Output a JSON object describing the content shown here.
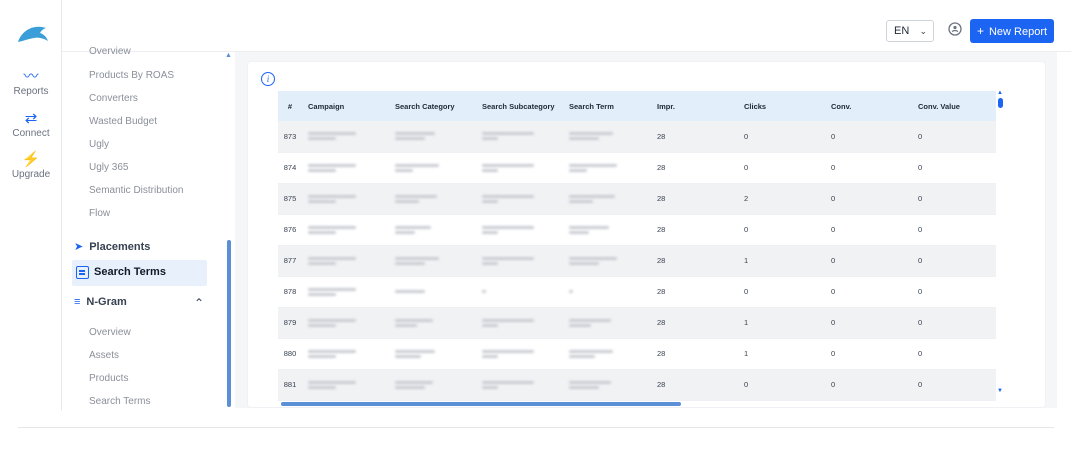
{
  "rail": {
    "items": [
      {
        "label": "Reports",
        "icon": "chart-trend-icon"
      },
      {
        "label": "Connect",
        "icon": "arrows-exchange-icon"
      },
      {
        "label": "Upgrade",
        "icon": "lightning-icon"
      }
    ]
  },
  "header": {
    "language": "EN",
    "new_report_label": "New Report"
  },
  "subnav": {
    "top_items": [
      "Overview",
      "Products By ROAS",
      "Converters",
      "Wasted Budget",
      "Ugly",
      "Ugly 365",
      "Semantic Distribution",
      "Flow"
    ],
    "placements_label": "Placements",
    "active_label": "Search Terms",
    "ngram_label": "N-Gram",
    "ngram_items": [
      "Overview",
      "Assets",
      "Products",
      "Search Terms"
    ]
  },
  "table": {
    "columns": [
      "#",
      "Campaign",
      "Search Category",
      "Search Subcategory",
      "Search Term",
      "Impr.",
      "Clicks",
      "Conv.",
      "Conv. Value"
    ],
    "rows": [
      {
        "id": "873",
        "impr": "28",
        "clicks": "0",
        "conv": "0",
        "conv_value": "0"
      },
      {
        "id": "874",
        "impr": "28",
        "clicks": "0",
        "conv": "0",
        "conv_value": "0"
      },
      {
        "id": "875",
        "impr": "28",
        "clicks": "2",
        "conv": "0",
        "conv_value": "0"
      },
      {
        "id": "876",
        "impr": "28",
        "clicks": "0",
        "conv": "0",
        "conv_value": "0"
      },
      {
        "id": "877",
        "impr": "28",
        "clicks": "1",
        "conv": "0",
        "conv_value": "0"
      },
      {
        "id": "878",
        "impr": "28",
        "clicks": "0",
        "conv": "0",
        "conv_value": "0"
      },
      {
        "id": "879",
        "impr": "28",
        "clicks": "1",
        "conv": "0",
        "conv_value": "0"
      },
      {
        "id": "880",
        "impr": "28",
        "clicks": "1",
        "conv": "0",
        "conv_value": "0"
      },
      {
        "id": "881",
        "impr": "28",
        "clicks": "0",
        "conv": "0",
        "conv_value": "0"
      }
    ]
  },
  "colors": {
    "accent": "#1c64f2",
    "header_row": "#e2eef9",
    "active_nav": "#e8f1fb"
  }
}
